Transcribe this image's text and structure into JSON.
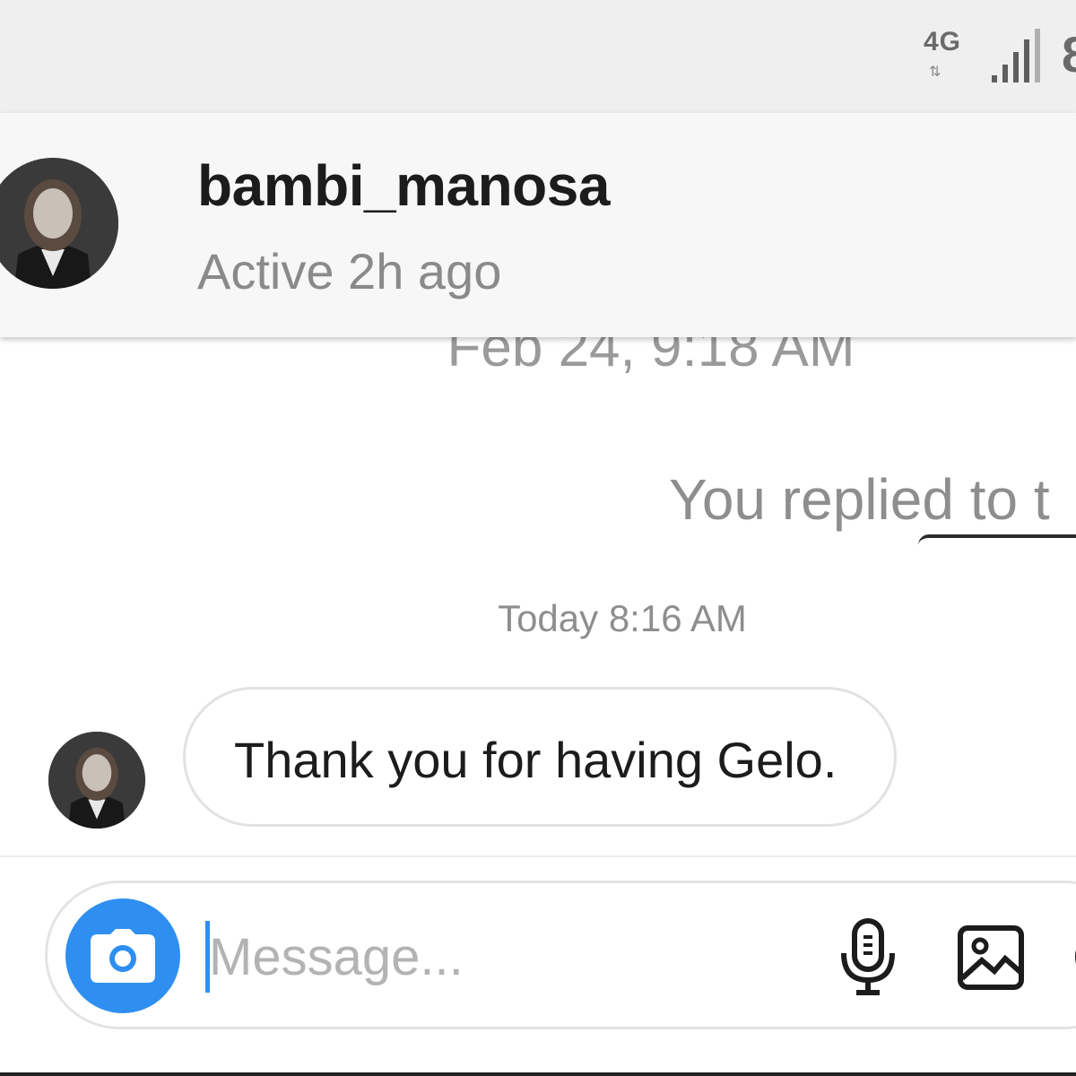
{
  "status_bar": {
    "network_type": "4G",
    "data_arrows": "⇅",
    "battery_partial": "8"
  },
  "header": {
    "username": "bambi_manosa",
    "active_status": "Active 2h ago"
  },
  "conversation": {
    "old_timestamp": "Feb 24, 9:18 AM",
    "reply_note": "You replied to t",
    "today_timestamp": "Today 8:16 AM",
    "messages": [
      {
        "text": "Thank you for having Gelo."
      }
    ]
  },
  "composer": {
    "placeholder": "Message..."
  },
  "icons": {
    "camera": "camera-icon",
    "mic": "microphone-icon",
    "gallery": "image-gallery-icon",
    "signal": "signal-icon"
  },
  "colors": {
    "accent": "#2f8ff0",
    "status_bar_bg": "#efefef",
    "header_bg": "#f7f7f7",
    "secondary_text": "#8e8e8e"
  }
}
